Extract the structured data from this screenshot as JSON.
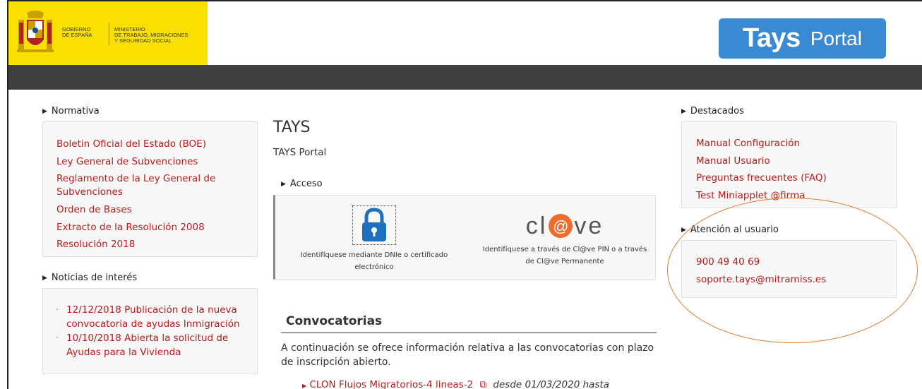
{
  "header": {
    "gov_line1": "GOBIERNO",
    "gov_line2": "DE ESPAÑA",
    "ministry_line1": "MINISTERIO",
    "ministry_line2": "DE TRABAJO, MIGRACIONES",
    "ministry_line3": "Y SEGURIDAD SOCIAL",
    "logo_main": "Tays",
    "logo_sub": "Portal",
    "logo_color": "#3a8ad3",
    "navbar_color": "#3f3f3f"
  },
  "normativa": {
    "title": "Normativa",
    "links": [
      "Boletin Oficial del Estado (BOE)",
      "Ley General de Subvenciones",
      "Reglamento de la Ley General de Subvenciones",
      "Orden de Bases",
      "Extracto de la Resolución 2008",
      "Resolución 2018"
    ]
  },
  "noticias": {
    "title": "Noticias de interés",
    "items": [
      "12/12/2018 Publicación de la nueva convocatoria de ayudas Inmigración",
      "10/10/2018 Abierta la solicitud de Ayudas para la Vivienda"
    ]
  },
  "main": {
    "title": "TAYS",
    "subtitle": "TAYS Portal",
    "acceso_title": "Acceso",
    "dnie_text": "Identifíquese mediante DNIe o certificado electrónico",
    "clave_logo_pre": "cl",
    "clave_logo_at": "@",
    "clave_logo_post": "ve",
    "clave_text": "Identifíquese a través de Cl@ve PIN o a través de Cl@ve Permanente",
    "convocatorias_title": "Convocatorias",
    "convocatorias_desc": "A continuación se ofrece información relativa a las convocatorias con plazo de inscripción abierto.",
    "convocatoria_item": "CLON Flujos Migratorios-4 lineas-2",
    "convocatoria_dates": "desde 01/03/2020 hasta"
  },
  "destacados": {
    "title": "Destacados",
    "links": [
      "Manual Configuración",
      "Manual Usuario",
      "Preguntas frecuentes (FAQ)",
      "Test Miniapplet @firma"
    ]
  },
  "atencion": {
    "title": "Atención al usuario",
    "phone": "900 49 40 69",
    "email": "soporte.tays@mitramiss.es"
  },
  "colors": {
    "link": "#b71c1c",
    "annotation": "#e07b2c",
    "clave_accent": "#ee6b2c",
    "gov_yellow": "#f9e000"
  }
}
